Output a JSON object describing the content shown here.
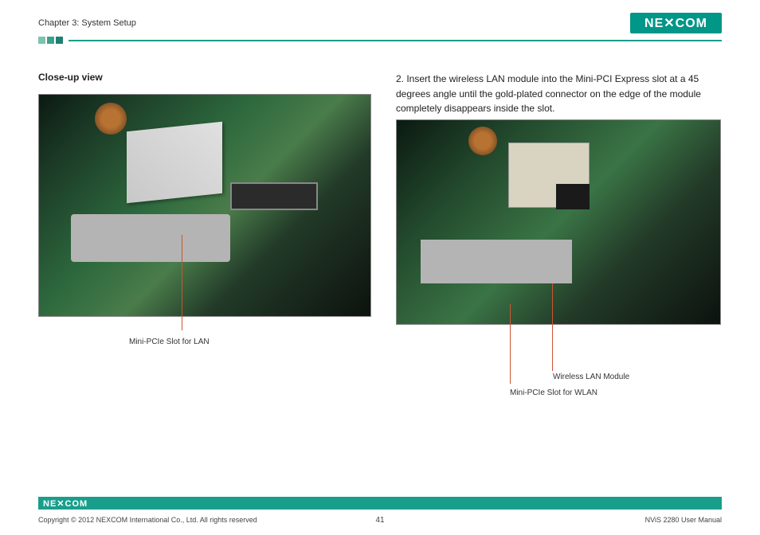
{
  "header": {
    "chapter_title": "Chapter 3: System Setup",
    "logo_text_top": "NE COM",
    "logo_text_bottom": "NE COM"
  },
  "left": {
    "heading": "Close-up view",
    "caption1": "Mini-PCIe Slot for LAN"
  },
  "right": {
    "step_number": "2.",
    "step_text": "Insert the wireless LAN module into the Mini-PCI Express slot at a 45 degrees angle until the gold-plated connector on the edge of the module completely disappears inside the slot.",
    "caption2a": "Wireless LAN Module",
    "caption2b": "Mini-PCIe Slot for WLAN"
  },
  "footer": {
    "copyright": "Copyright © 2012 NEXCOM International Co., Ltd. All rights reserved",
    "page_number": "41",
    "doc_title": "NViS 2280 User Manual"
  }
}
